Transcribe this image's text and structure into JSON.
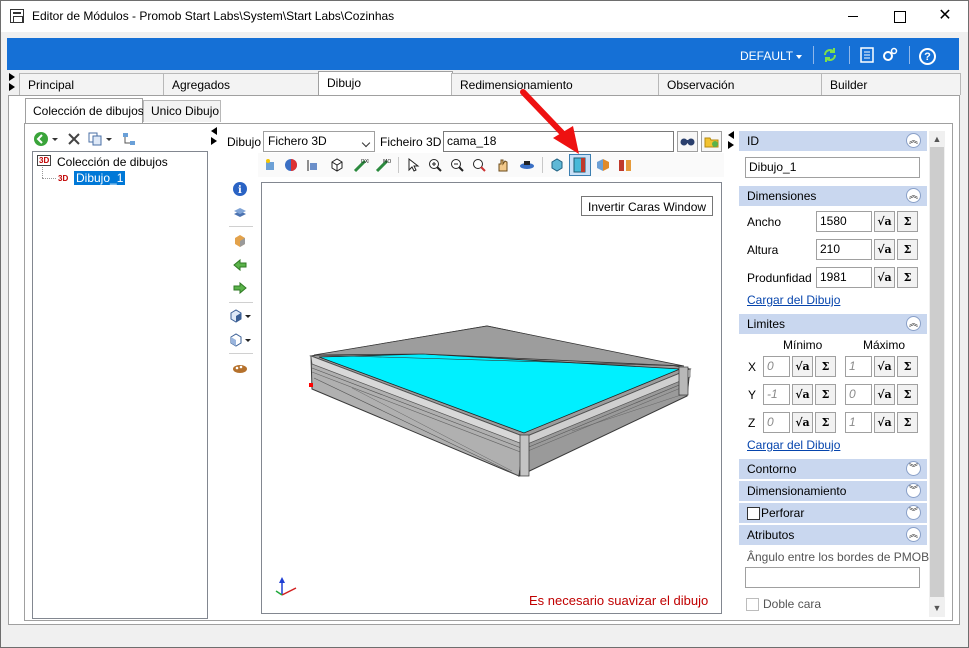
{
  "window": {
    "title": "Editor de Módulos - Promob Start Labs\\System\\Start Labs\\Cozinhas",
    "minimize": "—",
    "maximize": "",
    "close": "✕"
  },
  "header": {
    "profile": "DEFAULT",
    "help": "?"
  },
  "main_tabs": [
    {
      "label": "Principal"
    },
    {
      "label": "Agregados"
    },
    {
      "label": "Dibujo"
    },
    {
      "label": "Redimensionamiento"
    },
    {
      "label": "Observación"
    },
    {
      "label": "Builder"
    }
  ],
  "sub_tabs": [
    {
      "label": "Colección de dibujos"
    },
    {
      "label": "Unico Dibujo"
    }
  ],
  "tree": {
    "root_label": "Colección de dibujos",
    "child_label": "Dibujo_1",
    "badge": "3D"
  },
  "drawing": {
    "dibujo_label": "Dibujo",
    "dibujo_value": "Fichero 3D",
    "fichero_label": "Ficheiro 3D",
    "fichero_value": "cama_18"
  },
  "viewport": {
    "tooltip": "Invertir Caras Window",
    "message": "Es necesario suavizar el dibujo"
  },
  "panel": {
    "id_header": "ID",
    "id_value": "Dibujo_1",
    "dimensiones_header": "Dimensiones",
    "ancho_label": "Ancho",
    "ancho_value": "1580",
    "altura_label": "Altura",
    "altura_value": "210",
    "profundidad_label": "Produnfidad",
    "profundidad_value": "1981",
    "cargar_link": "Cargar del Dibujo",
    "limites_header": "Limites",
    "minimo_label": "Mínimo",
    "maximo_label": "Máximo",
    "x_label": "X",
    "y_label": "Y",
    "z_label": "Z",
    "x_min": "0",
    "x_max": "1",
    "y_min": "-1",
    "y_max": "0",
    "z_min": "0",
    "z_max": "1",
    "cargar_link_2": "Cargar del Dibujo",
    "contorno_header": "Contorno",
    "dimensionamiento_header": "Dimensionamiento",
    "perforar_header": "Perforar",
    "atributos_header": "Atributos",
    "angulo_label": "Ângulo entre los bordes de PMOB",
    "angulo_value": "",
    "doble_cara_label": "Doble cara",
    "sigma": "Σ",
    "sqrt": "√a"
  }
}
